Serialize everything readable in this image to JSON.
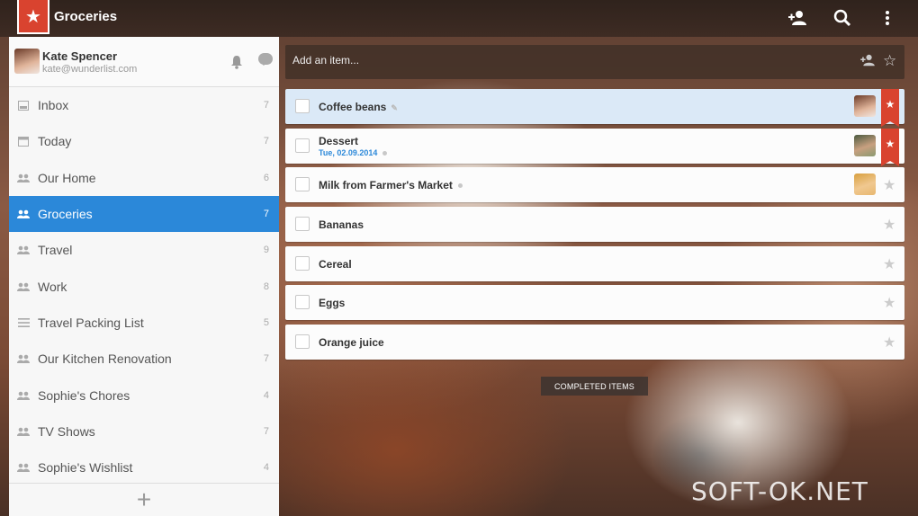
{
  "header": {
    "list_title": "Groceries",
    "icons": [
      "add-person-icon",
      "search-icon",
      "more-vertical-icon"
    ]
  },
  "user": {
    "name": "Kate Spencer",
    "email": "kate@wunderlist.com"
  },
  "sidebar": {
    "items": [
      {
        "label": "Inbox",
        "count": "7",
        "icon": "inbox-icon"
      },
      {
        "label": "Today",
        "count": "7",
        "icon": "calendar-icon"
      },
      {
        "label": "Our Home",
        "count": "6",
        "icon": "shared-list-icon"
      },
      {
        "label": "Groceries",
        "count": "7",
        "icon": "shared-list-icon",
        "active": true
      },
      {
        "label": "Travel",
        "count": "9",
        "icon": "shared-list-icon"
      },
      {
        "label": "Work",
        "count": "8",
        "icon": "shared-list-icon"
      },
      {
        "label": "Travel Packing List",
        "count": "5",
        "icon": "list-icon"
      },
      {
        "label": "Our Kitchen Renovation",
        "count": "7",
        "icon": "shared-list-icon"
      },
      {
        "label": "Sophie's Chores",
        "count": "4",
        "icon": "shared-list-icon"
      },
      {
        "label": "TV Shows",
        "count": "7",
        "icon": "shared-list-icon"
      },
      {
        "label": "Sophie's Wishlist",
        "count": "4",
        "icon": "shared-list-icon"
      }
    ],
    "add_label": "+"
  },
  "add_item": {
    "placeholder": "Add an item..."
  },
  "tasks": [
    {
      "title": "Coffee beans",
      "date": "",
      "starred": true,
      "assignee": true
    },
    {
      "title": "Dessert",
      "date": "Tue, 02.09.2014",
      "starred": true,
      "assignee": true
    },
    {
      "title": "Milk from Farmer's Market",
      "date": "",
      "starred": false,
      "assignee": true
    },
    {
      "title": "Bananas",
      "date": "",
      "starred": false,
      "assignee": false
    },
    {
      "title": "Cereal",
      "date": "",
      "starred": false,
      "assignee": false
    },
    {
      "title": "Eggs",
      "date": "",
      "starred": false,
      "assignee": false
    },
    {
      "title": "Orange juice",
      "date": "",
      "starred": false,
      "assignee": false
    }
  ],
  "completed_label": "COMPLETED ITEMS",
  "watermark": "SOFT-OK.NET",
  "colors": {
    "accent": "#2b88d9",
    "brand": "#d9432f"
  }
}
